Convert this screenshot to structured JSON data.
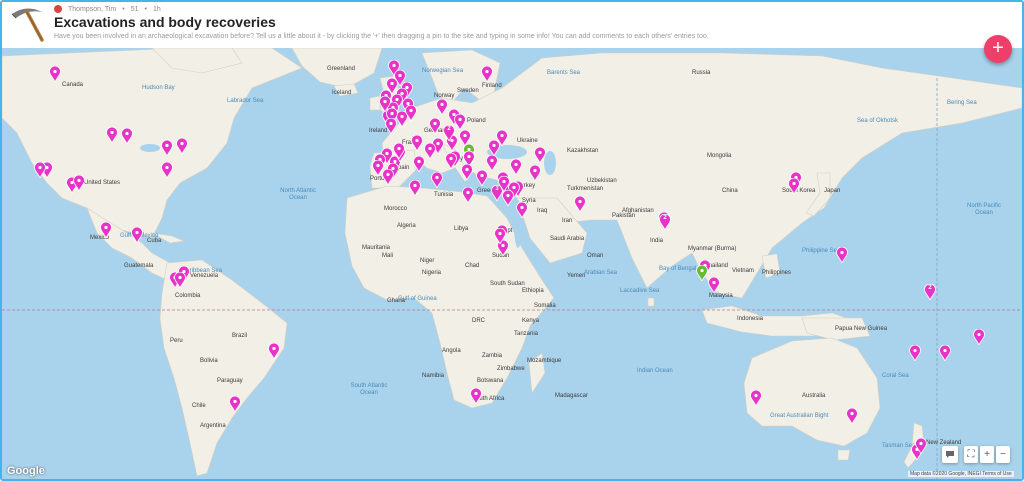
{
  "header": {
    "author": "Thompson, Tim",
    "post_count": "51",
    "age": "1h",
    "title": "Excavations and body recoveries",
    "description": "Have you been involved in an archaeological excavation before? Tell us a little about it - by clicking the '+' then dragging a pin to the site and typing in some info! You can add comments to each others' entries too."
  },
  "fab": {
    "label": "+"
  },
  "map": {
    "ocean_color": "#a9d3ec",
    "land_color": "#f2efe6",
    "pin_color": "#e833c8",
    "pin_green": "#66bb33",
    "countries": [
      {
        "text": "Canada"
      },
      {
        "text": "United States"
      },
      {
        "text": "Mexico"
      },
      {
        "text": "Cuba"
      },
      {
        "text": "Guatemala"
      },
      {
        "text": "Venezuela"
      },
      {
        "text": "Colombia"
      },
      {
        "text": "Peru"
      },
      {
        "text": "Brazil"
      },
      {
        "text": "Bolivia"
      },
      {
        "text": "Paraguay"
      },
      {
        "text": "Chile"
      },
      {
        "text": "Argentina"
      },
      {
        "text": "Greenland"
      },
      {
        "text": "Iceland"
      },
      {
        "text": "Sweden"
      },
      {
        "text": "Finland"
      },
      {
        "text": "Norway"
      },
      {
        "text": "Ireland"
      },
      {
        "text": "Germany"
      },
      {
        "text": "Poland"
      },
      {
        "text": "Ukraine"
      },
      {
        "text": "France"
      },
      {
        "text": "Spain"
      },
      {
        "text": "Portugal"
      },
      {
        "text": "Italy"
      },
      {
        "text": "Greece"
      },
      {
        "text": "Turkey"
      },
      {
        "text": "Russia"
      },
      {
        "text": "Kazakhstan"
      },
      {
        "text": "Mongolia"
      },
      {
        "text": "China"
      },
      {
        "text": "Uzbekistan"
      },
      {
        "text": "Turkmenistan"
      },
      {
        "text": "Afghanistan"
      },
      {
        "text": "Pakistan"
      },
      {
        "text": "Iran"
      },
      {
        "text": "Iraq"
      },
      {
        "text": "Syria"
      },
      {
        "text": "Saudi Arabia"
      },
      {
        "text": "Oman"
      },
      {
        "text": "Yemen"
      },
      {
        "text": "India"
      },
      {
        "text": "Myanmar (Burma)"
      },
      {
        "text": "Thailand"
      },
      {
        "text": "Vietnam"
      },
      {
        "text": "Philippines"
      },
      {
        "text": "Malaysia"
      },
      {
        "text": "Indonesia"
      },
      {
        "text": "Papua New Guinea"
      },
      {
        "text": "Japan"
      },
      {
        "text": "South Korea"
      },
      {
        "text": "Morocco"
      },
      {
        "text": "Algeria"
      },
      {
        "text": "Libya"
      },
      {
        "text": "Egypt"
      },
      {
        "text": "Mauritania"
      },
      {
        "text": "Mali"
      },
      {
        "text": "Niger"
      },
      {
        "text": "Chad"
      },
      {
        "text": "Sudan"
      },
      {
        "text": "South Sudan"
      },
      {
        "text": "Ethiopia"
      },
      {
        "text": "Somalia"
      },
      {
        "text": "Nigeria"
      },
      {
        "text": "DRC"
      },
      {
        "text": "Kenya"
      },
      {
        "text": "Tanzania"
      },
      {
        "text": "Angola"
      },
      {
        "text": "Zambia"
      },
      {
        "text": "Namibia"
      },
      {
        "text": "Botswana"
      },
      {
        "text": "Zimbabwe"
      },
      {
        "text": "Mozambique"
      },
      {
        "text": "Madagascar"
      },
      {
        "text": "South Africa"
      },
      {
        "text": "Australia"
      },
      {
        "text": "New Zealand"
      },
      {
        "text": "Tunisia"
      },
      {
        "text": "Ghana"
      }
    ],
    "oceans": [
      {
        "text": "North Atlantic Ocean"
      },
      {
        "text": "South Atlantic Ocean"
      },
      {
        "text": "Indian Ocean"
      },
      {
        "text": "North Pacific Ocean"
      },
      {
        "text": "Arabian Sea"
      },
      {
        "text": "Bay of Bengal"
      },
      {
        "text": "Philippine Sea"
      },
      {
        "text": "Coral Sea"
      },
      {
        "text": "Tasman Sea"
      },
      {
        "text": "Laccadive Sea"
      },
      {
        "text": "Caribbean Sea"
      },
      {
        "text": "Gulf of Mexico"
      },
      {
        "text": "Labrador Sea"
      },
      {
        "text": "Hudson Bay"
      },
      {
        "text": "Barents Sea"
      },
      {
        "text": "Bering Sea"
      },
      {
        "text": "Sea of Okhotsk"
      },
      {
        "text": "Great Australian Bight"
      },
      {
        "text": "Gulf of Guinea"
      },
      {
        "text": "Norwegian Sea"
      }
    ],
    "pins": [
      {
        "c": "m"
      },
      {
        "c": "m"
      },
      {
        "c": "m"
      },
      {
        "c": "m"
      },
      {
        "c": "m"
      },
      {
        "c": "m"
      },
      {
        "c": "m"
      },
      {
        "c": "m"
      },
      {
        "c": "m"
      },
      {
        "c": "m"
      },
      {
        "c": "m"
      },
      {
        "c": "m"
      },
      {
        "c": "m"
      },
      {
        "c": "m"
      },
      {
        "c": "m"
      },
      {
        "c": "m"
      },
      {
        "c": "m"
      },
      {
        "c": "m"
      },
      {
        "c": "m"
      },
      {
        "c": "m"
      },
      {
        "c": "m"
      },
      {
        "c": "m"
      },
      {
        "c": "m"
      },
      {
        "c": "m"
      },
      {
        "c": "m"
      },
      {
        "c": "m"
      },
      {
        "c": "m"
      },
      {
        "c": "m"
      },
      {
        "c": "m"
      },
      {
        "c": "m"
      },
      {
        "c": "m"
      },
      {
        "c": "m"
      },
      {
        "c": "m"
      },
      {
        "c": "m"
      },
      {
        "c": "m"
      },
      {
        "c": "m"
      },
      {
        "c": "m"
      },
      {
        "c": "g"
      },
      {
        "c": "m"
      },
      {
        "c": "m"
      },
      {
        "c": "m"
      },
      {
        "c": "m"
      },
      {
        "c": "m"
      },
      {
        "c": "m"
      },
      {
        "c": "m"
      },
      {
        "c": "m"
      },
      {
        "c": "m",
        "n": "3"
      },
      {
        "c": "m"
      },
      {
        "c": "m"
      },
      {
        "c": "m"
      },
      {
        "c": "m"
      },
      {
        "c": "m"
      },
      {
        "c": "m"
      },
      {
        "c": "m"
      },
      {
        "c": "m"
      },
      {
        "c": "m"
      },
      {
        "c": "m"
      },
      {
        "c": "m"
      },
      {
        "c": "m"
      },
      {
        "c": "m"
      },
      {
        "c": "m"
      },
      {
        "c": "m"
      },
      {
        "c": "m"
      },
      {
        "c": "m"
      },
      {
        "c": "m"
      },
      {
        "c": "m",
        "n": "2"
      },
      {
        "c": "m"
      },
      {
        "c": "m"
      },
      {
        "c": "m"
      },
      {
        "c": "m"
      },
      {
        "c": "m"
      },
      {
        "c": "m"
      },
      {
        "c": "m"
      },
      {
        "c": "m"
      },
      {
        "c": "m"
      },
      {
        "c": "m"
      },
      {
        "c": "m"
      },
      {
        "c": "m"
      },
      {
        "c": "m"
      },
      {
        "c": "g"
      },
      {
        "c": "m"
      },
      {
        "c": "m"
      },
      {
        "c": "m",
        "n": "2"
      },
      {
        "c": "m"
      },
      {
        "c": "m"
      },
      {
        "c": "m"
      },
      {
        "c": "m"
      },
      {
        "c": "m"
      },
      {
        "c": "m",
        "n": "2"
      },
      {
        "c": "m"
      },
      {
        "c": "m"
      },
      {
        "c": "m"
      },
      {
        "c": "m"
      },
      {
        "c": "m"
      },
      {
        "c": "m"
      },
      {
        "c": "m"
      },
      {
        "c": "m"
      }
    ]
  },
  "controls": {
    "comment_icon": "speech-bubble-icon",
    "fullscreen_label": "⛶",
    "zoom_in": "+",
    "zoom_out": "−"
  },
  "footer": {
    "brand": "Google",
    "attribution": "Map data ©2020 Google, INEGI   Terms of Use"
  }
}
